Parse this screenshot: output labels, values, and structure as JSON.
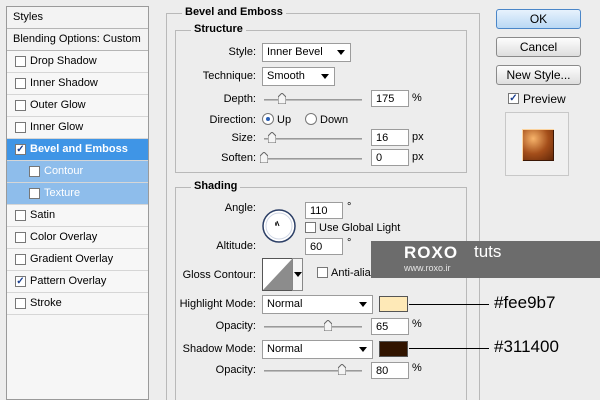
{
  "styles_panel": {
    "header": "Styles",
    "blending_options": "Blending Options: Custom",
    "items": [
      {
        "label": "Drop Shadow",
        "checked": false
      },
      {
        "label": "Inner Shadow",
        "checked": false
      },
      {
        "label": "Outer Glow",
        "checked": false
      },
      {
        "label": "Inner Glow",
        "checked": false
      },
      {
        "label": "Bevel and Emboss",
        "checked": true
      },
      {
        "label": "Contour",
        "checked": false
      },
      {
        "label": "Texture",
        "checked": false
      },
      {
        "label": "Satin",
        "checked": false
      },
      {
        "label": "Color Overlay",
        "checked": false
      },
      {
        "label": "Gradient Overlay",
        "checked": false
      },
      {
        "label": "Pattern Overlay",
        "checked": true
      },
      {
        "label": "Stroke",
        "checked": false
      }
    ]
  },
  "bevel_emboss": {
    "title": "Bevel and Emboss",
    "structure": {
      "title": "Structure",
      "style_label": "Style:",
      "style_value": "Inner Bevel",
      "technique_label": "Technique:",
      "technique_value": "Smooth",
      "depth_label": "Depth:",
      "depth_value": "175",
      "depth_unit": "%",
      "depth_level": 0.18,
      "direction_label": "Direction:",
      "direction_up": "Up",
      "direction_down": "Down",
      "direction_selected": "Up",
      "size_label": "Size:",
      "size_value": "16",
      "size_unit": "px",
      "size_level": 0.08,
      "soften_label": "Soften:",
      "soften_value": "0",
      "soften_unit": "px",
      "soften_level": 0.0
    },
    "shading": {
      "title": "Shading",
      "angle_label": "Angle:",
      "angle_value": "110",
      "angle_unit": "°",
      "use_global_light": "Use Global Light",
      "use_global_light_checked": false,
      "altitude_label": "Altitude:",
      "altitude_value": "60",
      "altitude_unit": "°",
      "gloss_contour_label": "Gloss Contour:",
      "anti_aliased": "Anti-aliased",
      "anti_aliased_checked": false,
      "highlight_mode_label": "Highlight Mode:",
      "highlight_mode_value": "Normal",
      "highlight_color": "#fee9b7",
      "highlight_opacity_label": "Opacity:",
      "highlight_opacity_value": "65",
      "highlight_opacity_unit": "%",
      "highlight_opacity_level": 0.65,
      "shadow_mode_label": "Shadow Mode:",
      "shadow_mode_value": "Normal",
      "shadow_color": "#311400",
      "shadow_opacity_label": "Opacity:",
      "shadow_opacity_value": "80",
      "shadow_opacity_unit": "%",
      "shadow_opacity_level": 0.8
    }
  },
  "buttons": {
    "ok": "OK",
    "cancel": "Cancel",
    "new_style": "New Style...",
    "preview": "Preview",
    "preview_checked": true
  },
  "annotations": {
    "highlight_hex": "#fee9b7",
    "shadow_hex": "#311400"
  },
  "watermark": {
    "brand_a": "RO",
    "brand_b": "X",
    "brand_c": "O",
    "brand_d": "tuts",
    "url": "www.roxo.ir"
  }
}
